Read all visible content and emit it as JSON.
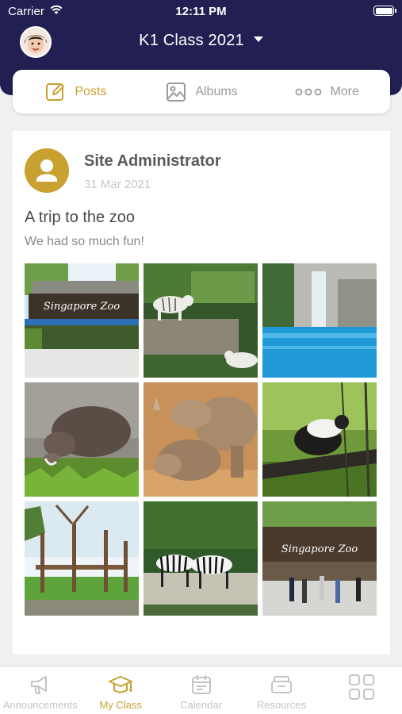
{
  "status_bar": {
    "carrier": "Carrier",
    "time": "12:11 PM"
  },
  "header": {
    "class_name": "K1 Class 2021"
  },
  "tabs": [
    {
      "label": "Posts",
      "icon": "edit-icon",
      "active": true
    },
    {
      "label": "Albums",
      "icon": "image-icon",
      "active": false
    },
    {
      "label": "More",
      "icon": "more-dots-icon",
      "active": false
    }
  ],
  "post": {
    "author": "Site Administrator",
    "date": "31 Mar 2021",
    "title": "A trip to the zoo",
    "body": "We had so much fun!",
    "photos": [
      {
        "icon": "zoo-entrance-photo",
        "sign": "Singapore Zoo"
      },
      {
        "icon": "white-tigers-photo"
      },
      {
        "icon": "waterfall-pool-photo"
      },
      {
        "icon": "warthog-photo"
      },
      {
        "icon": "rhinos-photo"
      },
      {
        "icon": "monkey-photo"
      },
      {
        "icon": "wooden-play-structure-photo"
      },
      {
        "icon": "zebras-photo"
      },
      {
        "icon": "zoo-entrance-crowd-photo",
        "sign": "Singapore Zoo"
      }
    ]
  },
  "bottom_nav": [
    {
      "label": "Announcements",
      "icon": "megaphone-icon",
      "active": false
    },
    {
      "label": "My Class",
      "icon": "graduation-cap-icon",
      "active": true
    },
    {
      "label": "Calendar",
      "icon": "calendar-icon",
      "active": false
    },
    {
      "label": "Resources",
      "icon": "resources-icon",
      "active": false
    },
    {
      "label": "",
      "icon": "grid-menu-icon",
      "active": false
    }
  ],
  "colors": {
    "header_bg": "#221f52",
    "accent": "#c9a131",
    "inactive": "#c4c4c4"
  }
}
